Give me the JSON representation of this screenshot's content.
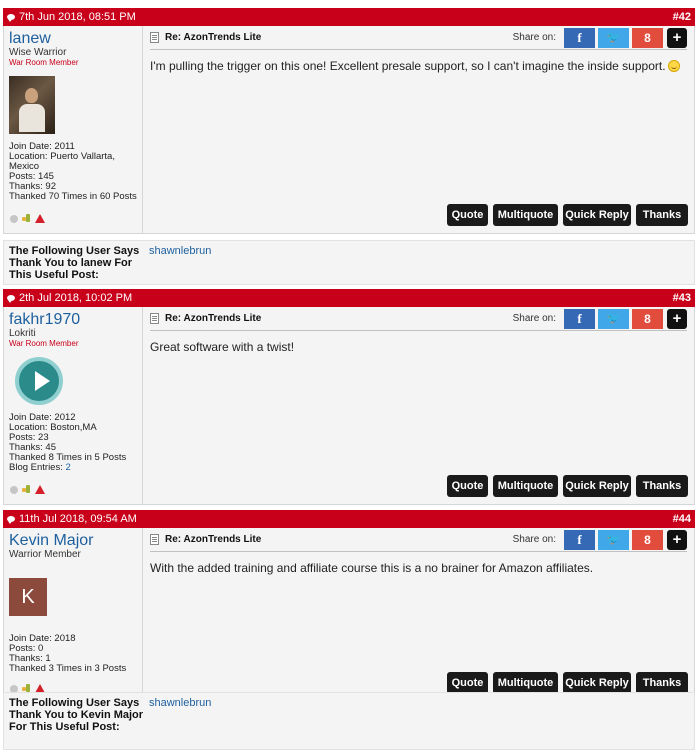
{
  "posts": [
    {
      "date": "7th Jun 2018, 08:51 PM",
      "number": "#42",
      "username": "lanew",
      "usertitle": "Wise Warrior",
      "rank": "War Room Member",
      "stats": [
        "Join Date: 2011",
        "Location: Puerto Vallarta,",
        "Mexico",
        "Posts: 145",
        "Thanks: 92",
        "Thanked 70 Times in 60 Posts"
      ],
      "title": "Re: AzonTrends Lite",
      "message": "I'm pulling the trigger on this one! Excellent presale support, so I can't imagine the inside support."
    },
    {
      "date": "2th Jul 2018, 10:02 PM",
      "number": "#43",
      "username": "fakhr1970",
      "usertitle": "Lokriti",
      "rank": "War Room Member",
      "stats": [
        "Join Date: 2012",
        "Location: Boston,MA",
        "Posts: 23",
        "Thanks: 45",
        "Thanked 8 Times in 5 Posts"
      ],
      "blog_label": "Blog Entries: ",
      "blog_count": "2",
      "title": "Re: AzonTrends Lite",
      "message": "Great software with a twist!"
    },
    {
      "date": "11th Jul 2018, 09:54 AM",
      "number": "#44",
      "username": "Kevin Major",
      "usertitle": "Warrior Member",
      "avatar_letter": "K",
      "stats": [
        "Join Date: 2018",
        "Posts: 0",
        "Thanks: 1",
        "Thanked 3 Times in 3 Posts"
      ],
      "title": "Re: AzonTrends Lite",
      "message": "With the added training and affiliate course this is a no brainer for Amazon affiliates."
    }
  ],
  "share_label": "Share on:",
  "share_icons": {
    "facebook": "f",
    "twitter": "🐦",
    "google": "8",
    "more": "+"
  },
  "buttons": {
    "quote": "Quote",
    "multiquote": "Multiquote",
    "quick_reply": "Quick Reply",
    "thanks": "Thanks"
  },
  "thanks_boxes": [
    {
      "label": "The Following User Says Thank You to lanew For This Useful Post:",
      "user": "shawnlebrun"
    },
    {
      "label": "The Following User Says Thank You to Kevin Major For This Useful Post:",
      "user": "shawnlebrun"
    }
  ],
  "colors": {
    "header": "#c8001a",
    "username": "#1d5f9e",
    "button": "#1a1a1a"
  }
}
